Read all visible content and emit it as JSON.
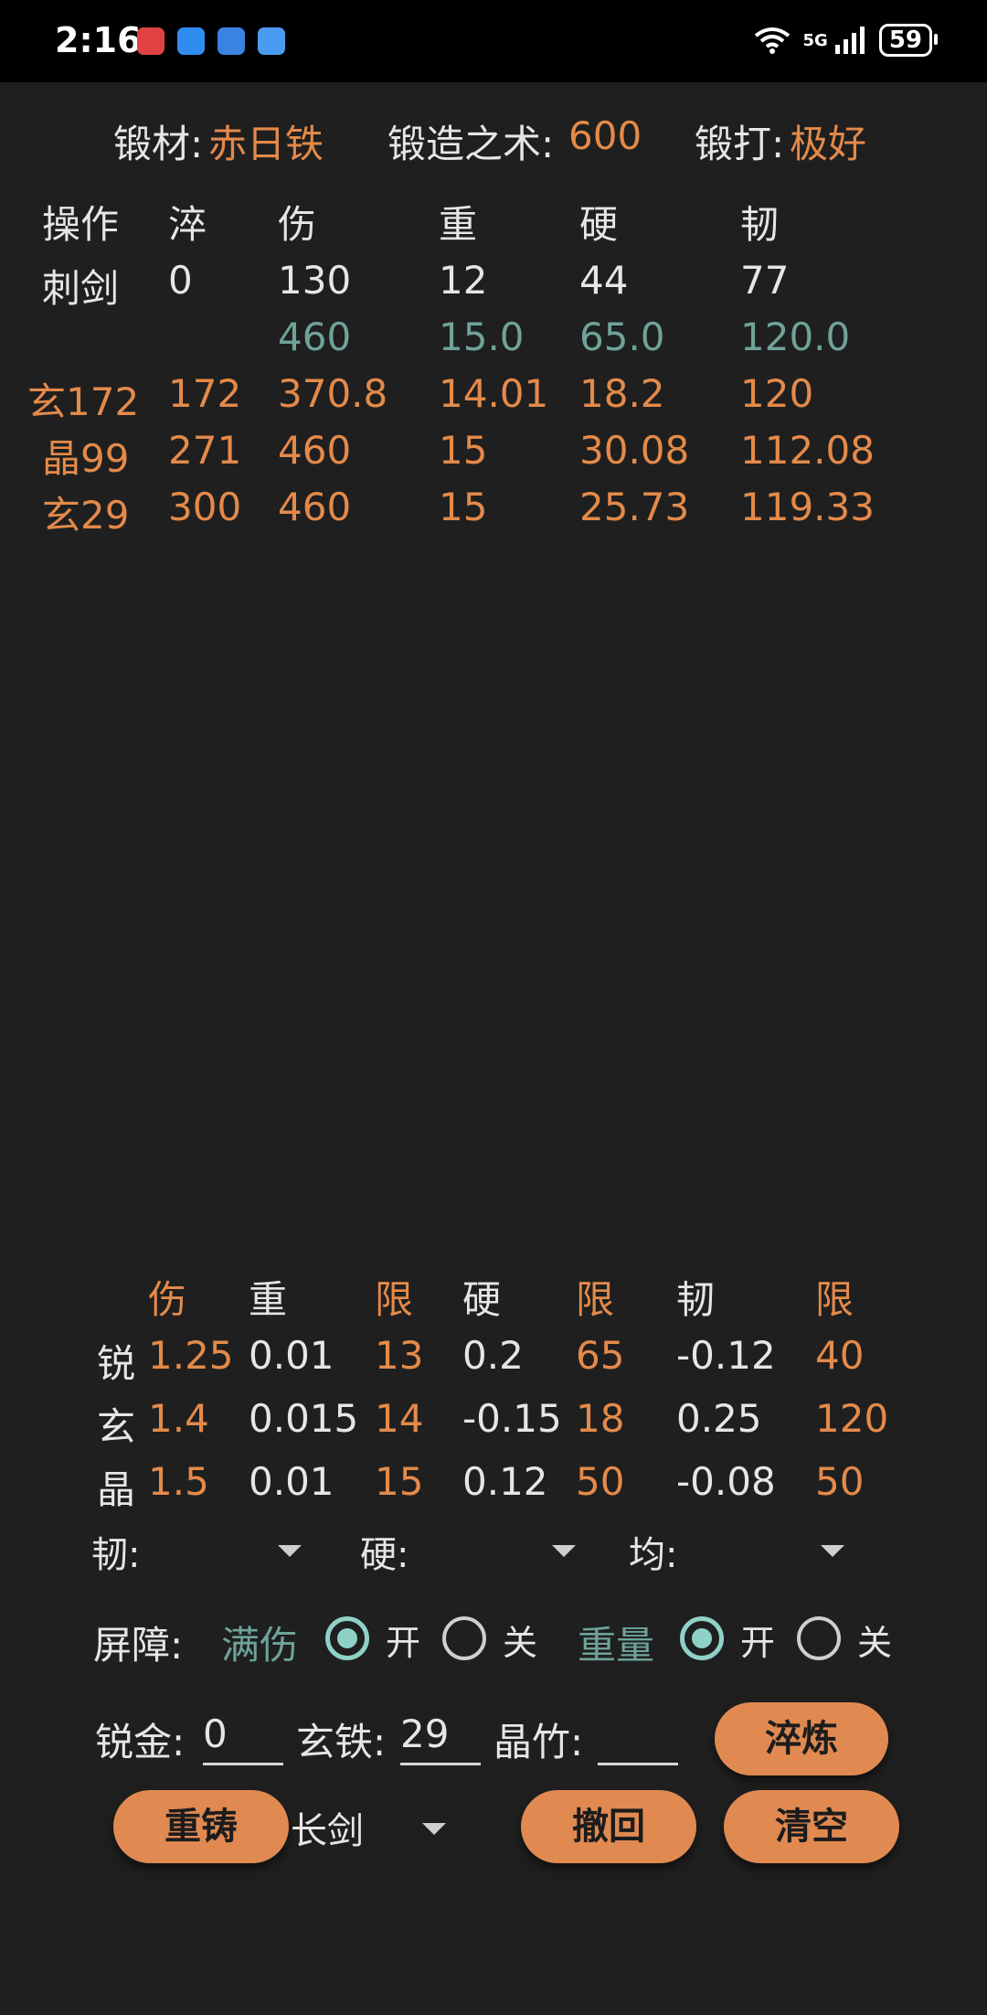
{
  "status_bar": {
    "time": "2:16",
    "network": "5G",
    "battery": "59"
  },
  "header": {
    "material_label": "锻材:",
    "material_value": "赤日铁",
    "skill_label": "锻造之术:",
    "skill_value": "600",
    "forge_label": "锻打:",
    "forge_value": "极好"
  },
  "table": {
    "headers": [
      "操作",
      "淬",
      "伤",
      "重",
      "硬",
      "韧"
    ],
    "base_row": [
      "刺剑",
      "0",
      "130",
      "12",
      "44",
      "77"
    ],
    "limit_row": [
      "",
      "",
      "460",
      "15.0",
      "65.0",
      "120.0"
    ],
    "rows": [
      [
        "玄172",
        "172",
        "370.8",
        "14.01",
        "18.2",
        "120"
      ],
      [
        "晶99",
        "271",
        "460",
        "15",
        "30.08",
        "112.08"
      ],
      [
        "玄29",
        "300",
        "460",
        "15",
        "25.73",
        "119.33"
      ]
    ]
  },
  "coef": {
    "headers": [
      "伤",
      "重",
      "限",
      "硬",
      "限",
      "韧",
      "限"
    ],
    "rows": [
      {
        "name": "锐",
        "cells": [
          "1.25",
          "0.01",
          "13",
          "0.2",
          "65",
          "-0.12",
          "40"
        ]
      },
      {
        "name": "玄",
        "cells": [
          "1.4",
          "0.015",
          "14",
          "-0.15",
          "18",
          "0.25",
          "120"
        ]
      },
      {
        "name": "晶",
        "cells": [
          "1.5",
          "0.01",
          "15",
          "0.12",
          "50",
          "-0.08",
          "50"
        ]
      }
    ]
  },
  "dropdowns": {
    "toughness": "韧:",
    "hardness": "硬:",
    "balance": "均:"
  },
  "barrier": {
    "label": "屏障:",
    "full_damage": "满伤",
    "weight": "重量",
    "on": "开",
    "off": "关"
  },
  "inputs": {
    "sharp_label": "锐金:",
    "sharp_value": "0",
    "xuan_label": "玄铁:",
    "xuan_value": "29",
    "crystal_label": "晶竹:",
    "crystal_value": ""
  },
  "buttons": {
    "temper": "淬炼",
    "recast": "重铸",
    "undo": "撤回",
    "clear": "清空"
  },
  "weapon_select": "长剑"
}
